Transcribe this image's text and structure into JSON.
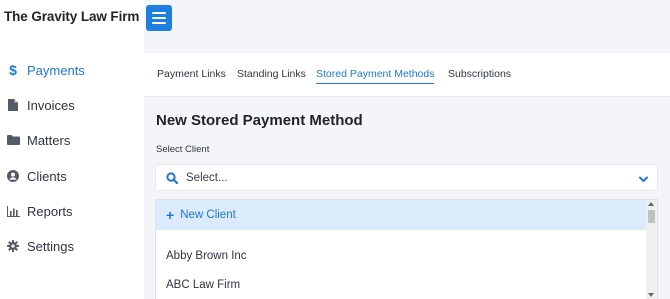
{
  "brand": "The Gravity Law Firm",
  "sidebar": {
    "items": [
      {
        "label": "Payments",
        "icon": "dollar-icon",
        "active": true
      },
      {
        "label": "Invoices",
        "icon": "file-icon",
        "active": false
      },
      {
        "label": "Matters",
        "icon": "folder-icon",
        "active": false
      },
      {
        "label": "Clients",
        "icon": "user-circle-icon",
        "active": false
      },
      {
        "label": "Reports",
        "icon": "bar-chart-icon",
        "active": false
      },
      {
        "label": "Settings",
        "icon": "gear-icon",
        "active": false
      }
    ]
  },
  "tabs": [
    {
      "label": "Payment Links",
      "active": false
    },
    {
      "label": "Standing Links",
      "active": false
    },
    {
      "label": "Stored Payment Methods",
      "active": true
    },
    {
      "label": "Subscriptions",
      "active": false
    }
  ],
  "main": {
    "title": "New Stored Payment Method",
    "select_label": "Select Client",
    "select_placeholder": "Select..."
  },
  "dropdown": {
    "new_client": "New Client",
    "options": [
      "Abby Brown Inc",
      "ABC Law Firm"
    ]
  },
  "colors": {
    "accent": "#1f78d1",
    "menu_button": "#1e7fe0",
    "highlight": "#dcebfb",
    "background": "#f3f5f8"
  }
}
